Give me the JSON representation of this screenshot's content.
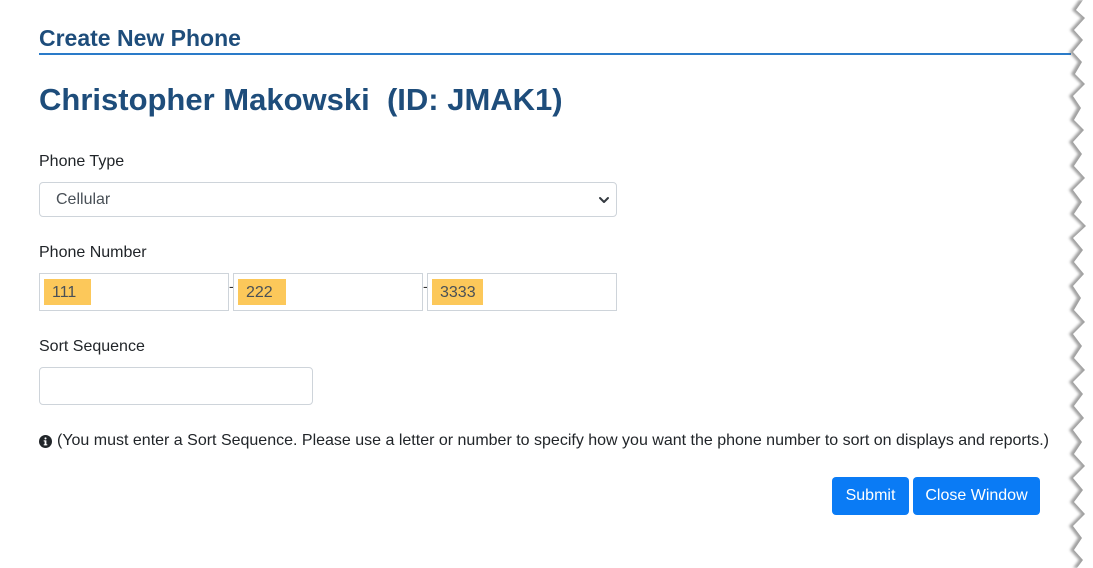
{
  "header": {
    "title": "Create New Phone"
  },
  "person": {
    "display": "Christopher Makowski  (ID: JMAK1)"
  },
  "form": {
    "phone_type": {
      "label": "Phone Type",
      "selected": "Cellular"
    },
    "phone_number": {
      "label": "Phone Number",
      "area_code": "111",
      "prefix": "222",
      "line": "3333",
      "separator": "-"
    },
    "sort_sequence": {
      "label": "Sort Sequence",
      "value": ""
    },
    "info": {
      "icon": "info-circle-icon",
      "text": "(You must enter a Sort Sequence. Please use a letter or number to specify how you want the phone number to sort on displays and reports.)"
    }
  },
  "actions": {
    "submit_label": "Submit",
    "close_label": "Close Window"
  },
  "colors": {
    "heading": "#1e4d7b",
    "rule": "#2a7bc9",
    "button": "#0a7bf5",
    "highlight": "#fcc85a"
  }
}
